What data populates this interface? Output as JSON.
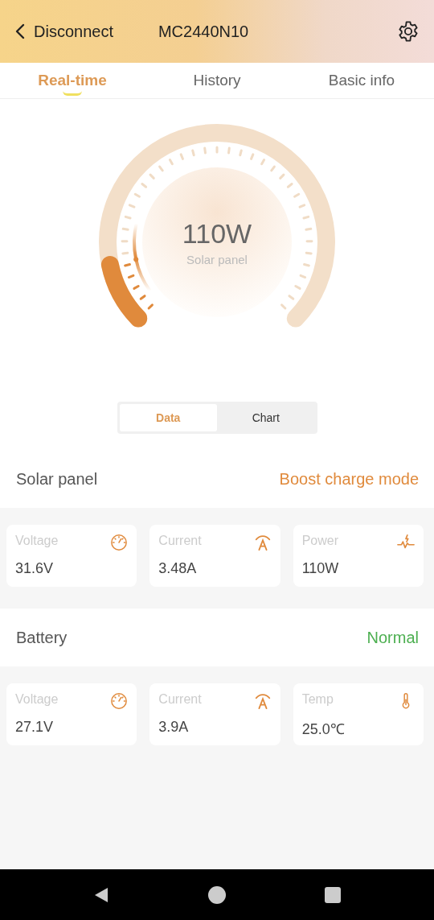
{
  "header": {
    "back_label": "Disconnect",
    "title": "MC2440N10"
  },
  "tabs": [
    {
      "label": "Real-time",
      "selected": true
    },
    {
      "label": "History",
      "selected": false
    },
    {
      "label": "Basic info",
      "selected": false
    }
  ],
  "gauge": {
    "value": "110W",
    "label": "Solar panel"
  },
  "view_toggle": [
    {
      "label": "Data",
      "selected": true
    },
    {
      "label": "Chart",
      "selected": false
    }
  ],
  "sections": [
    {
      "title": "Solar panel",
      "status": "Boost charge mode",
      "color": "#e08a3c",
      "cards": [
        {
          "label": "Voltage",
          "value": "31.6V",
          "kind": "voltage"
        },
        {
          "label": "Current",
          "value": "3.48A",
          "kind": "current"
        },
        {
          "label": "Power",
          "value": "110W",
          "kind": "power"
        }
      ]
    },
    {
      "title": "Battery",
      "status": "Normal",
      "color": "#4caf50",
      "cards": [
        {
          "label": "Voltage",
          "value": "27.1V",
          "kind": "voltage"
        },
        {
          "label": "Current",
          "value": "3.9A",
          "kind": "current"
        },
        {
          "label": "Temp",
          "value": "25.0℃",
          "kind": "temp"
        }
      ]
    }
  ]
}
